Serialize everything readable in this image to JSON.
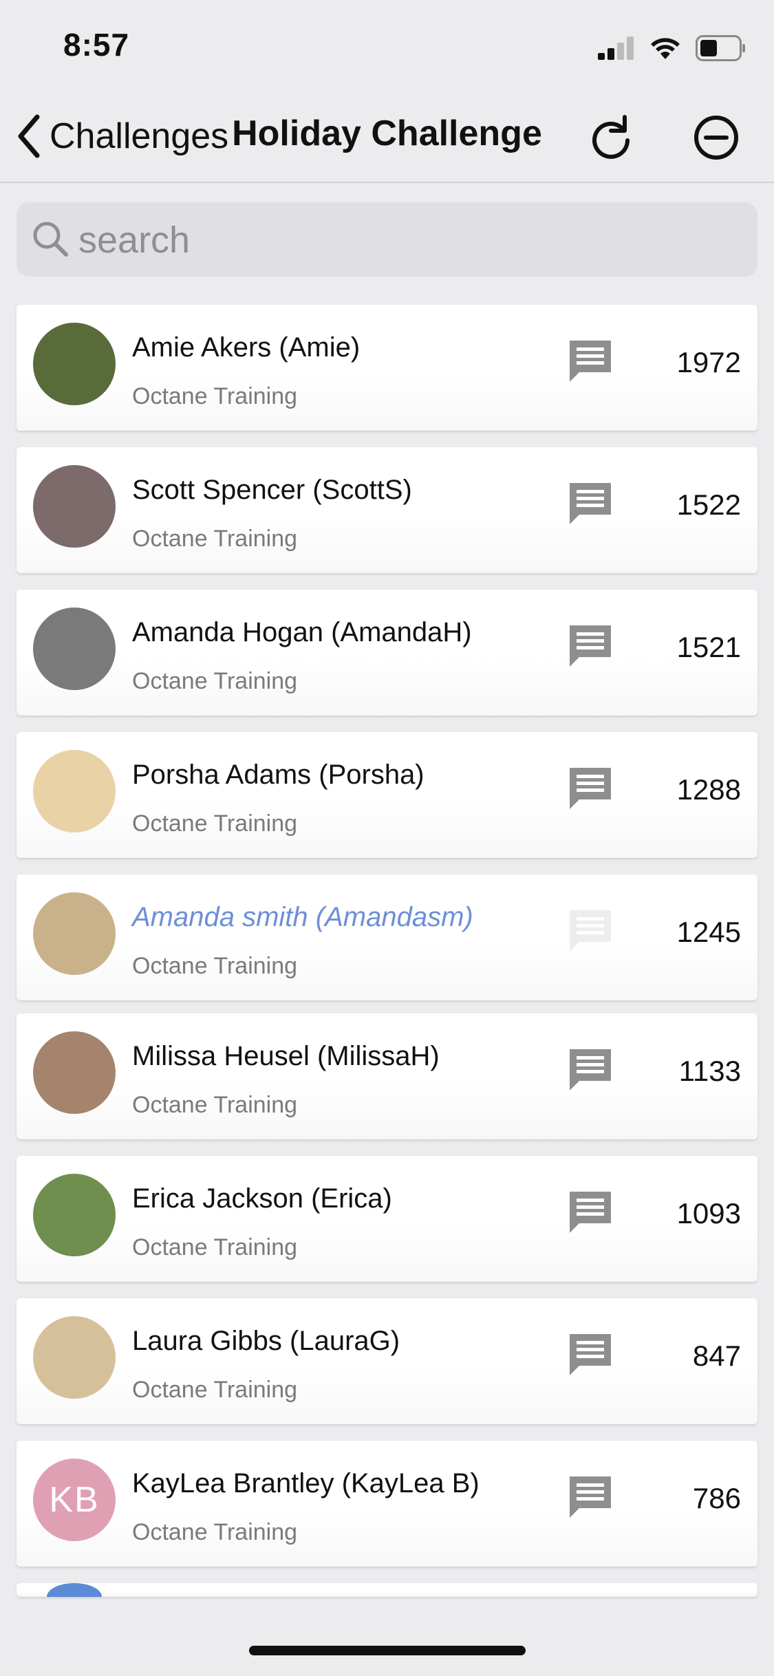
{
  "status": {
    "time": "8:57"
  },
  "nav": {
    "back_label": "Challenges",
    "title": "Holiday Challenge"
  },
  "search": {
    "placeholder": "search",
    "value": ""
  },
  "participants": [
    {
      "name": "Amie Akers (Amie)",
      "team": "Octane Training",
      "score": "1972",
      "avatar_color": "#5a6b3a",
      "highlighted": false,
      "initials": ""
    },
    {
      "name": "Scott Spencer (ScottS)",
      "team": "Octane Training",
      "score": "1522",
      "avatar_color": "#7d6a6a",
      "highlighted": false,
      "initials": ""
    },
    {
      "name": "Amanda Hogan (AmandaH)",
      "team": "Octane Training",
      "score": "1521",
      "avatar_color": "#7a7a7a",
      "highlighted": false,
      "initials": ""
    },
    {
      "name": "Porsha Adams (Porsha)",
      "team": "Octane Training",
      "score": "1288",
      "avatar_color": "#e9d2a6",
      "highlighted": false,
      "initials": ""
    },
    {
      "name": "Amanda smith (Amandasm)",
      "team": "Octane Training",
      "score": "1245",
      "avatar_color": "#c9b18a",
      "highlighted": true,
      "initials": ""
    },
    {
      "name": "Milissa Heusel (MilissaH)",
      "team": "Octane Training",
      "score": "1133",
      "avatar_color": "#a4846c",
      "highlighted": false,
      "initials": ""
    },
    {
      "name": "Erica Jackson (Erica)",
      "team": "Octane Training",
      "score": "1093",
      "avatar_color": "#6f8f4e",
      "highlighted": false,
      "initials": ""
    },
    {
      "name": "Laura Gibbs (LauraG)",
      "team": "Octane Training",
      "score": "847",
      "avatar_color": "#d6c09a",
      "highlighted": false,
      "initials": ""
    },
    {
      "name": "KayLea Brantley (KayLea B)",
      "team": "Octane Training",
      "score": "786",
      "avatar_color": "#e0a0b4",
      "highlighted": false,
      "initials": "KB"
    }
  ]
}
